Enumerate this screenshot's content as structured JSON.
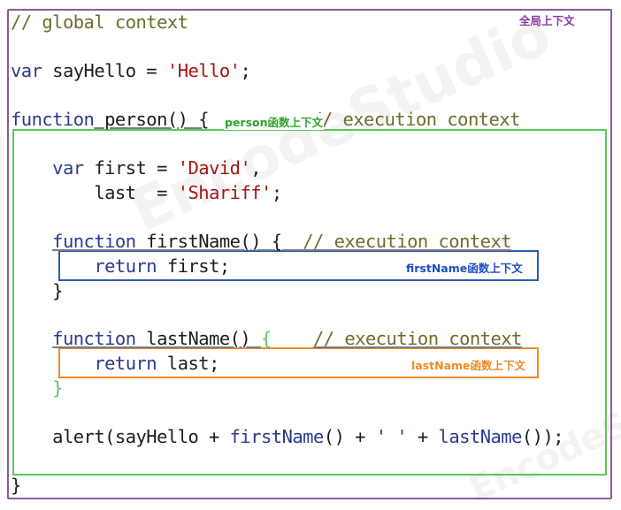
{
  "watermark": "EncodeStudio",
  "labels": {
    "global": "全局上下文",
    "person": "person函数上下文",
    "first_name": "firstName函数上下文",
    "last_name": "lastName函数上下文"
  },
  "code": {
    "l1": {
      "comment": "// global context"
    },
    "l2": {
      "kw": "var",
      "rest": " sayHello = ",
      "str": "'Hello'",
      "end": ";"
    },
    "l3": {
      "kw": "function",
      "name": " person() {",
      "comment": "// execution context"
    },
    "l4": {
      "indent": "    ",
      "kw": "var",
      "rest": " first = ",
      "str": "'David'",
      "end": ","
    },
    "l5": {
      "indent": "        ",
      "rest": "last  = ",
      "str": "'Shariff'",
      "end": ";"
    },
    "l6": {
      "indent": "    ",
      "kw": "function",
      "name": " firstName() {  ",
      "comment": "// execution context"
    },
    "l7": {
      "indent": "        ",
      "kw": "return",
      "rest": " first;"
    },
    "l8": {
      "indent": "    ",
      "brace": "}"
    },
    "l9": {
      "indent": "    ",
      "kw": "function",
      "name": " lastName() ",
      "brace": "{",
      "gap": "    ",
      "comment": "// execution context"
    },
    "l10": {
      "indent": "        ",
      "kw": "return",
      "rest": " last;"
    },
    "l11": {
      "indent": "    ",
      "brace": "}"
    },
    "l12": {
      "indent": "    ",
      "part1": "alert(sayHello + ",
      "fn1": "firstName",
      "part2": "() + ",
      "str": "' '",
      "part3": " + ",
      "fn2": "lastName",
      "part4": "());"
    },
    "l13": {
      "brace": "}"
    }
  },
  "colors": {
    "global_frame": "#8a5a9c",
    "person_box": "#5ac85a",
    "firstname_box": "#2d5bb0",
    "lastname_box": "#f08a24"
  }
}
